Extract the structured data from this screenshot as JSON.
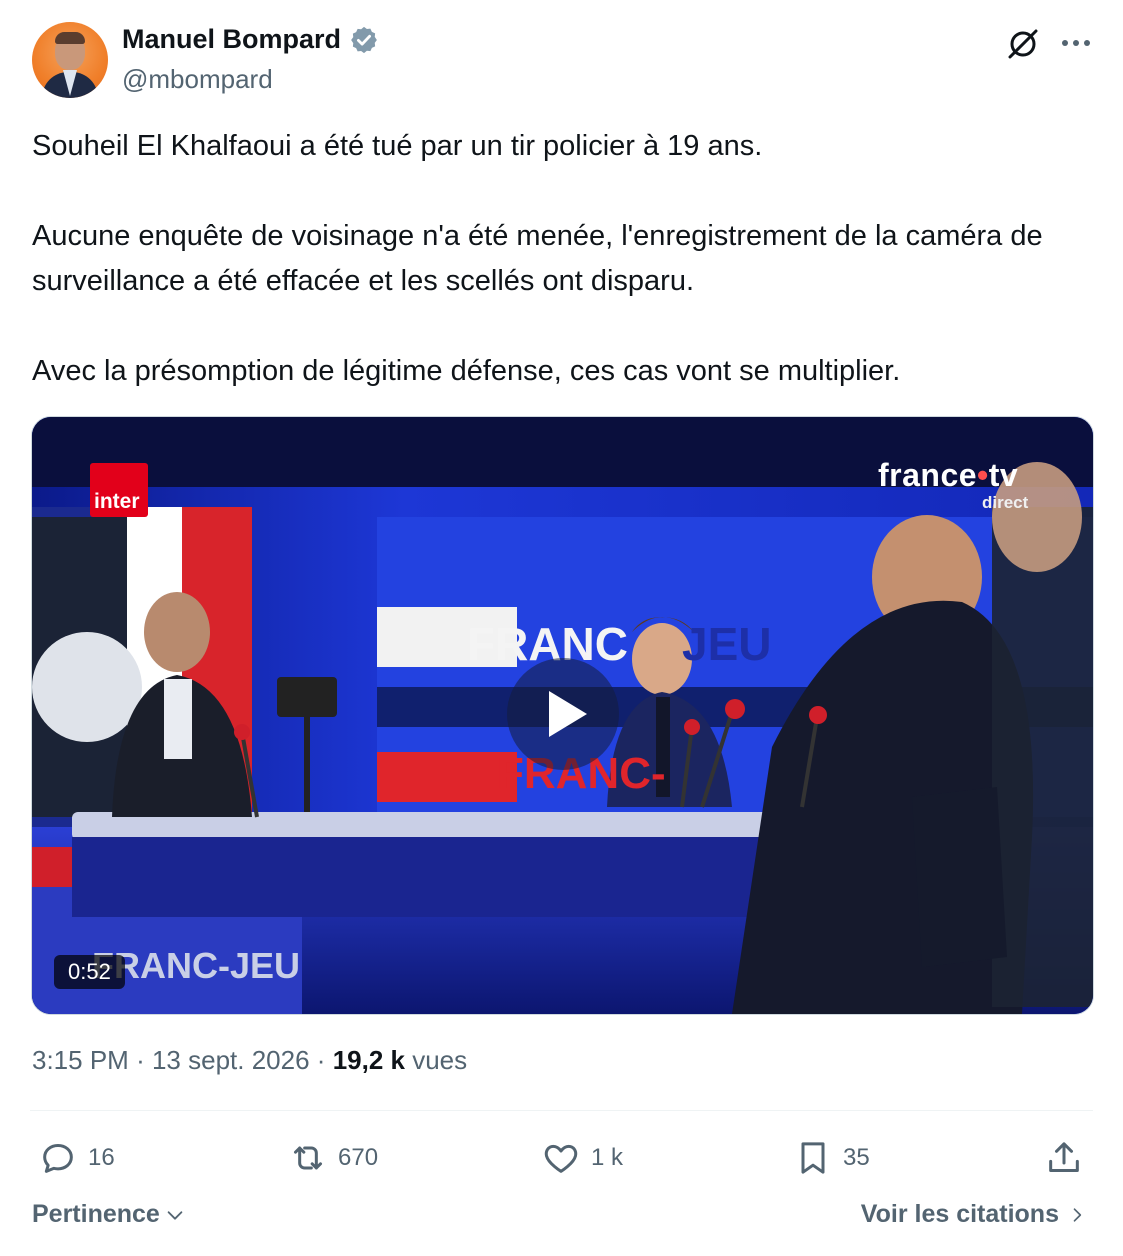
{
  "author": {
    "display_name": "Manuel Bompard",
    "handle": "@mbompard",
    "verified": true
  },
  "tweet": {
    "paragraphs": [
      "Souheil El Khalfaoui a été tué par un tir policier à 19 ans.",
      "Aucune enquête de voisinage n'a été menée, l'enregistrement de la caméra de surveillance a été effacée et les scellés ont disparu.",
      "Avec la présomption de légitime défense, ces cas vont se multiplier."
    ]
  },
  "video": {
    "duration": "0:52",
    "broadcaster_logo_left": "france",
    "broadcaster_logo": "france",
    "broadcaster_logo_suffix": "tv",
    "broadcaster_direct": "direct",
    "radio_logo": "inter",
    "set_text_1": "FRANC",
    "set_text_2": "JEU",
    "set_text_3": "FRANC-",
    "set_text_4": "FRANC-JEU"
  },
  "meta": {
    "time": "3:15 PM",
    "separator": "·",
    "date": "13 sept. 2026",
    "views_count": "19,2 k",
    "views_label": "vues"
  },
  "actions": {
    "replies": "16",
    "retweets": "670",
    "likes": "1 k",
    "bookmarks": "35"
  },
  "footer": {
    "sort_label": "Pertinence",
    "quotes_label": "Voir les citations"
  },
  "icons": {
    "verified": "verified-badge-icon",
    "grok": "grok-icon",
    "more": "more-icon",
    "reply": "reply-icon",
    "retweet": "retweet-icon",
    "like": "heart-icon",
    "bookmark": "bookmark-icon",
    "share": "share-icon"
  },
  "colors": {
    "text_primary": "#0f1419",
    "text_secondary": "#536471",
    "verified_badge": "#829aab"
  }
}
